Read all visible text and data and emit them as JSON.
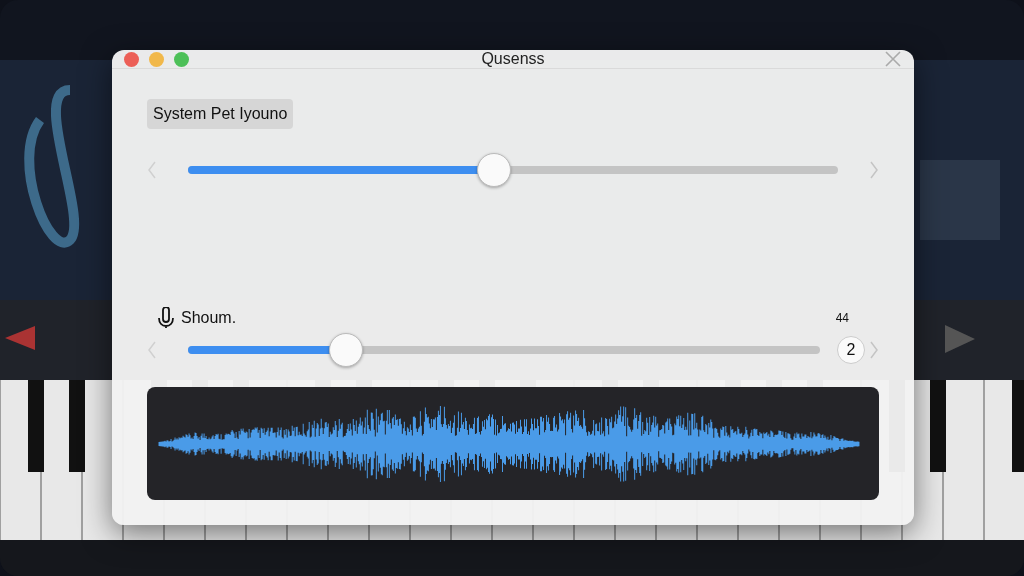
{
  "window": {
    "title": "Qusenss"
  },
  "sections": [
    {
      "kind": "chip",
      "label": "System Pet Iyouno",
      "slider": {
        "level": 0.47
      }
    },
    {
      "kind": "icon-label",
      "label": "Shoum.",
      "value_label": "44",
      "slider": {
        "level": 0.25,
        "end_value": "2"
      }
    }
  ],
  "waveform": {
    "kind": "waveform"
  }
}
